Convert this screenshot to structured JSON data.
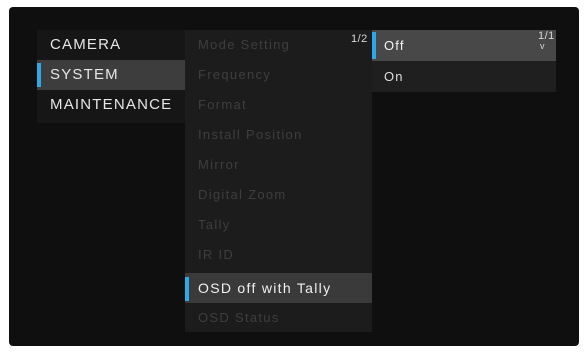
{
  "menu1": {
    "items": [
      {
        "label": "CAMERA"
      },
      {
        "label": "SYSTEM",
        "selected": true
      },
      {
        "label": "MAINTENANCE"
      }
    ]
  },
  "menu2": {
    "page": "1/2",
    "items": [
      {
        "label": "Mode Setting"
      },
      {
        "label": "Frequency"
      },
      {
        "label": "Format"
      },
      {
        "label": "Install Position"
      },
      {
        "label": "Mirror"
      },
      {
        "label": "Digital Zoom"
      },
      {
        "label": "Tally"
      },
      {
        "label": "IR ID"
      },
      {
        "label": "OSD off with Tally",
        "selected": true
      },
      {
        "label": "OSD Status"
      }
    ]
  },
  "menu3": {
    "page": "1/1",
    "scroll_glyph": "v",
    "items": [
      {
        "label": "Off",
        "selected": true
      },
      {
        "label": "On"
      }
    ]
  },
  "colors": {
    "accent": "#2da8e8",
    "screen_bg": "#0f0f0f",
    "dimmed_text": "#3e3e3e"
  }
}
